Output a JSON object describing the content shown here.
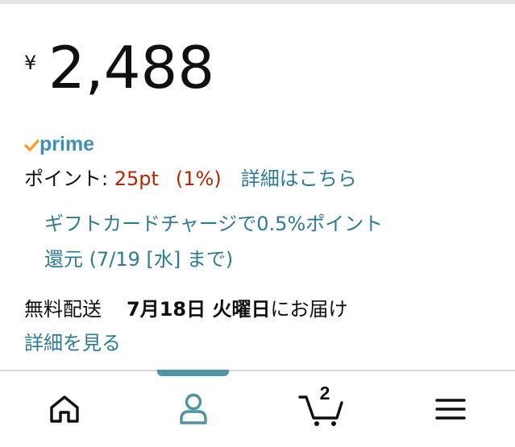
{
  "price": {
    "currency_symbol": "¥",
    "amount": "2,488"
  },
  "prime": {
    "label": "prime",
    "check_color": "#f0a12a",
    "label_color": "#3f8fb5"
  },
  "points": {
    "label": "ポイント: ",
    "value": "25pt",
    "percent": "(1%)",
    "details_link": "詳細はこちら"
  },
  "gift_card": {
    "line1": "ギフトカードチャージで0.5%ポイント",
    "line2": "還元 (7/19 [水] まで)"
  },
  "delivery": {
    "label": "無料配送",
    "date": "7月18日 火曜日",
    "suffix": "にお届け",
    "details_link": "詳細を見る"
  },
  "bottom_nav": {
    "items": [
      {
        "name": "home",
        "icon": "home-icon"
      },
      {
        "name": "account",
        "icon": "user-icon",
        "active": true
      },
      {
        "name": "cart",
        "icon": "cart-icon",
        "count": "2"
      },
      {
        "name": "menu",
        "icon": "hamburger-menu-icon"
      }
    ],
    "active_color": "#4f93a5"
  }
}
